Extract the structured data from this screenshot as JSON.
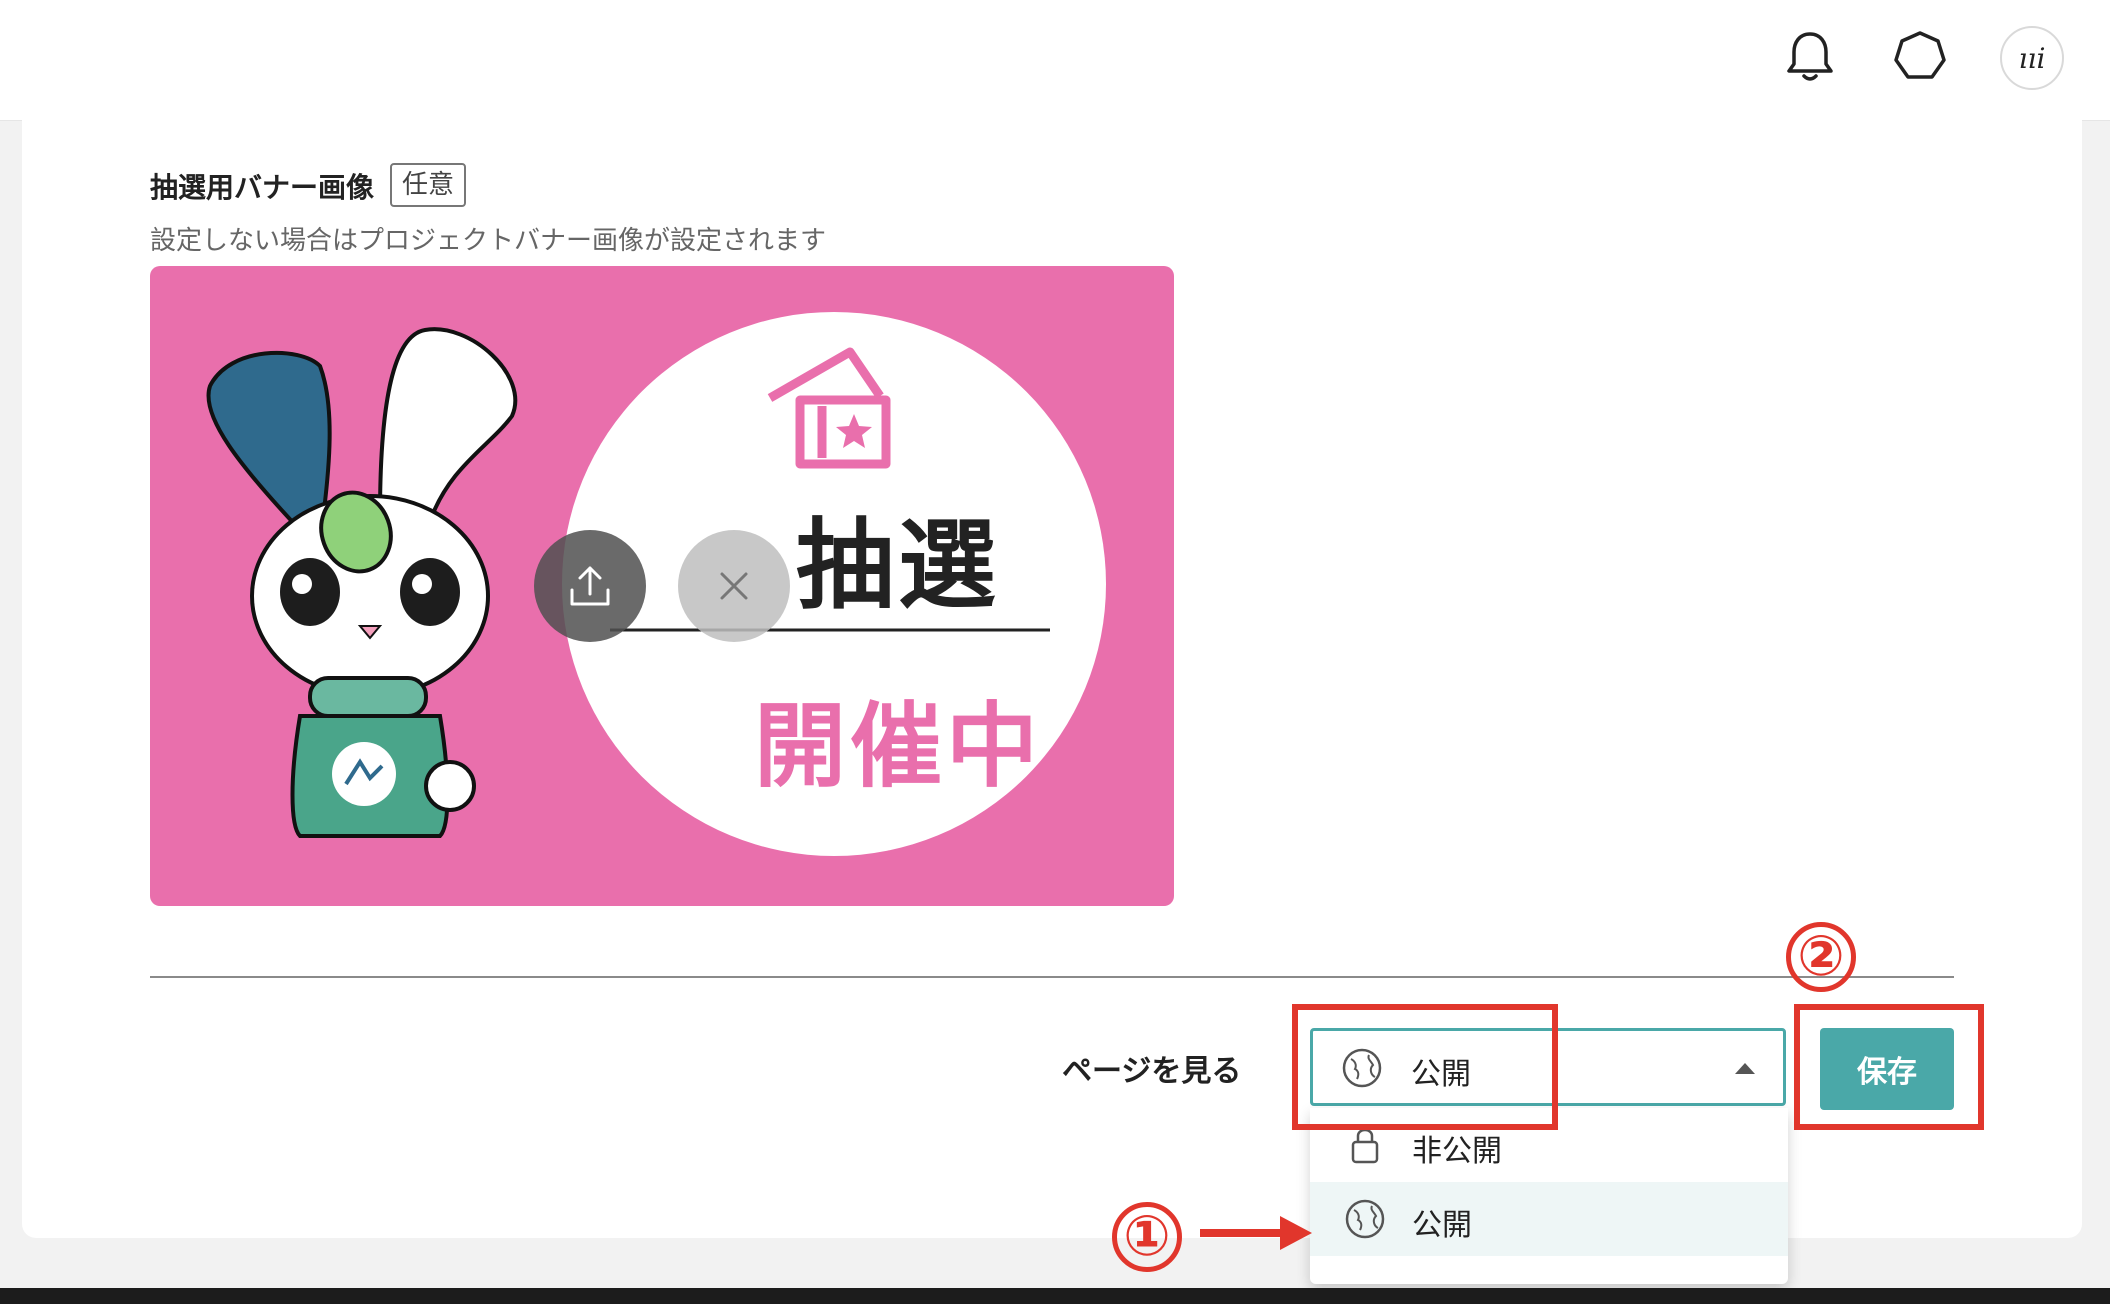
{
  "header": {
    "notification_icon": "bell-icon",
    "extension_icon": "heptagon-icon",
    "avatar_text": "ııi"
  },
  "banner_section": {
    "title": "抽選用バナー画像",
    "optional_badge": "任意",
    "help_text": "設定しない場合はプロジェクトバナー画像が設定されます",
    "image_text_top": "抽選",
    "image_text_bottom": "開催中",
    "upload_icon": "upload-icon",
    "remove_icon": "close-icon"
  },
  "footer": {
    "view_page_label": "ページを見る",
    "visibility_select": {
      "value": "公開",
      "icon": "globe-icon",
      "options": [
        {
          "label": "非公開",
          "icon": "lock-icon"
        },
        {
          "label": "公開",
          "icon": "globe-icon"
        }
      ]
    },
    "save_label": "保存"
  },
  "annotations": {
    "step1": "①",
    "step2": "②"
  },
  "colors": {
    "accent": "#4aa8a8",
    "banner_pink": "#e96fac",
    "annotation_red": "#e1362c"
  }
}
